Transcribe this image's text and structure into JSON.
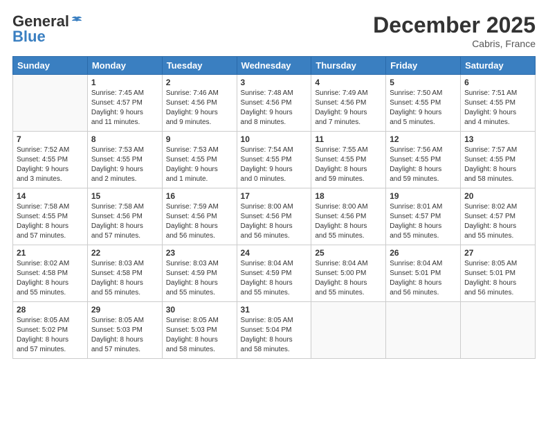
{
  "header": {
    "logo_line1": "General",
    "logo_line2": "Blue",
    "month": "December 2025",
    "location": "Cabris, France"
  },
  "columns": [
    "Sunday",
    "Monday",
    "Tuesday",
    "Wednesday",
    "Thursday",
    "Friday",
    "Saturday"
  ],
  "weeks": [
    [
      {
        "day": "",
        "text": ""
      },
      {
        "day": "1",
        "text": "Sunrise: 7:45 AM\nSunset: 4:57 PM\nDaylight: 9 hours\nand 11 minutes."
      },
      {
        "day": "2",
        "text": "Sunrise: 7:46 AM\nSunset: 4:56 PM\nDaylight: 9 hours\nand 9 minutes."
      },
      {
        "day": "3",
        "text": "Sunrise: 7:48 AM\nSunset: 4:56 PM\nDaylight: 9 hours\nand 8 minutes."
      },
      {
        "day": "4",
        "text": "Sunrise: 7:49 AM\nSunset: 4:56 PM\nDaylight: 9 hours\nand 7 minutes."
      },
      {
        "day": "5",
        "text": "Sunrise: 7:50 AM\nSunset: 4:55 PM\nDaylight: 9 hours\nand 5 minutes."
      },
      {
        "day": "6",
        "text": "Sunrise: 7:51 AM\nSunset: 4:55 PM\nDaylight: 9 hours\nand 4 minutes."
      }
    ],
    [
      {
        "day": "7",
        "text": "Sunrise: 7:52 AM\nSunset: 4:55 PM\nDaylight: 9 hours\nand 3 minutes."
      },
      {
        "day": "8",
        "text": "Sunrise: 7:53 AM\nSunset: 4:55 PM\nDaylight: 9 hours\nand 2 minutes."
      },
      {
        "day": "9",
        "text": "Sunrise: 7:53 AM\nSunset: 4:55 PM\nDaylight: 9 hours\nand 1 minute."
      },
      {
        "day": "10",
        "text": "Sunrise: 7:54 AM\nSunset: 4:55 PM\nDaylight: 9 hours\nand 0 minutes."
      },
      {
        "day": "11",
        "text": "Sunrise: 7:55 AM\nSunset: 4:55 PM\nDaylight: 8 hours\nand 59 minutes."
      },
      {
        "day": "12",
        "text": "Sunrise: 7:56 AM\nSunset: 4:55 PM\nDaylight: 8 hours\nand 59 minutes."
      },
      {
        "day": "13",
        "text": "Sunrise: 7:57 AM\nSunset: 4:55 PM\nDaylight: 8 hours\nand 58 minutes."
      }
    ],
    [
      {
        "day": "14",
        "text": "Sunrise: 7:58 AM\nSunset: 4:55 PM\nDaylight: 8 hours\nand 57 minutes."
      },
      {
        "day": "15",
        "text": "Sunrise: 7:58 AM\nSunset: 4:56 PM\nDaylight: 8 hours\nand 57 minutes."
      },
      {
        "day": "16",
        "text": "Sunrise: 7:59 AM\nSunset: 4:56 PM\nDaylight: 8 hours\nand 56 minutes."
      },
      {
        "day": "17",
        "text": "Sunrise: 8:00 AM\nSunset: 4:56 PM\nDaylight: 8 hours\nand 56 minutes."
      },
      {
        "day": "18",
        "text": "Sunrise: 8:00 AM\nSunset: 4:56 PM\nDaylight: 8 hours\nand 55 minutes."
      },
      {
        "day": "19",
        "text": "Sunrise: 8:01 AM\nSunset: 4:57 PM\nDaylight: 8 hours\nand 55 minutes."
      },
      {
        "day": "20",
        "text": "Sunrise: 8:02 AM\nSunset: 4:57 PM\nDaylight: 8 hours\nand 55 minutes."
      }
    ],
    [
      {
        "day": "21",
        "text": "Sunrise: 8:02 AM\nSunset: 4:58 PM\nDaylight: 8 hours\nand 55 minutes."
      },
      {
        "day": "22",
        "text": "Sunrise: 8:03 AM\nSunset: 4:58 PM\nDaylight: 8 hours\nand 55 minutes."
      },
      {
        "day": "23",
        "text": "Sunrise: 8:03 AM\nSunset: 4:59 PM\nDaylight: 8 hours\nand 55 minutes."
      },
      {
        "day": "24",
        "text": "Sunrise: 8:04 AM\nSunset: 4:59 PM\nDaylight: 8 hours\nand 55 minutes."
      },
      {
        "day": "25",
        "text": "Sunrise: 8:04 AM\nSunset: 5:00 PM\nDaylight: 8 hours\nand 55 minutes."
      },
      {
        "day": "26",
        "text": "Sunrise: 8:04 AM\nSunset: 5:01 PM\nDaylight: 8 hours\nand 56 minutes."
      },
      {
        "day": "27",
        "text": "Sunrise: 8:05 AM\nSunset: 5:01 PM\nDaylight: 8 hours\nand 56 minutes."
      }
    ],
    [
      {
        "day": "28",
        "text": "Sunrise: 8:05 AM\nSunset: 5:02 PM\nDaylight: 8 hours\nand 57 minutes."
      },
      {
        "day": "29",
        "text": "Sunrise: 8:05 AM\nSunset: 5:03 PM\nDaylight: 8 hours\nand 57 minutes."
      },
      {
        "day": "30",
        "text": "Sunrise: 8:05 AM\nSunset: 5:03 PM\nDaylight: 8 hours\nand 58 minutes."
      },
      {
        "day": "31",
        "text": "Sunrise: 8:05 AM\nSunset: 5:04 PM\nDaylight: 8 hours\nand 58 minutes."
      },
      {
        "day": "",
        "text": ""
      },
      {
        "day": "",
        "text": ""
      },
      {
        "day": "",
        "text": ""
      }
    ]
  ]
}
